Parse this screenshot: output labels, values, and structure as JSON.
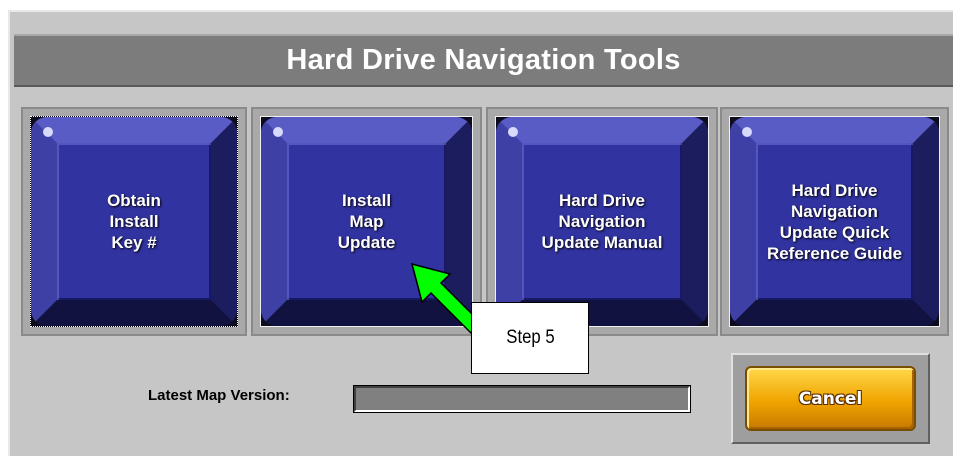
{
  "window": {
    "title": "Hard Drive Navigation Tools"
  },
  "tools": [
    {
      "label": "Obtain\nInstall\nKey #",
      "selected": true
    },
    {
      "label": "Install\nMap\nUpdate",
      "selected": false
    },
    {
      "label": "Hard Drive\nNavigation\nUpdate Manual",
      "selected": false
    },
    {
      "label": "Hard Drive\nNavigation\nUpdate Quick\nReference Guide",
      "selected": false
    }
  ],
  "footer": {
    "version_label": "Latest Map Version:",
    "version_value": "",
    "cancel_label": "Cancel"
  },
  "annotation": {
    "callout_text": "Step 5",
    "arrow_color": "#00ff00"
  }
}
